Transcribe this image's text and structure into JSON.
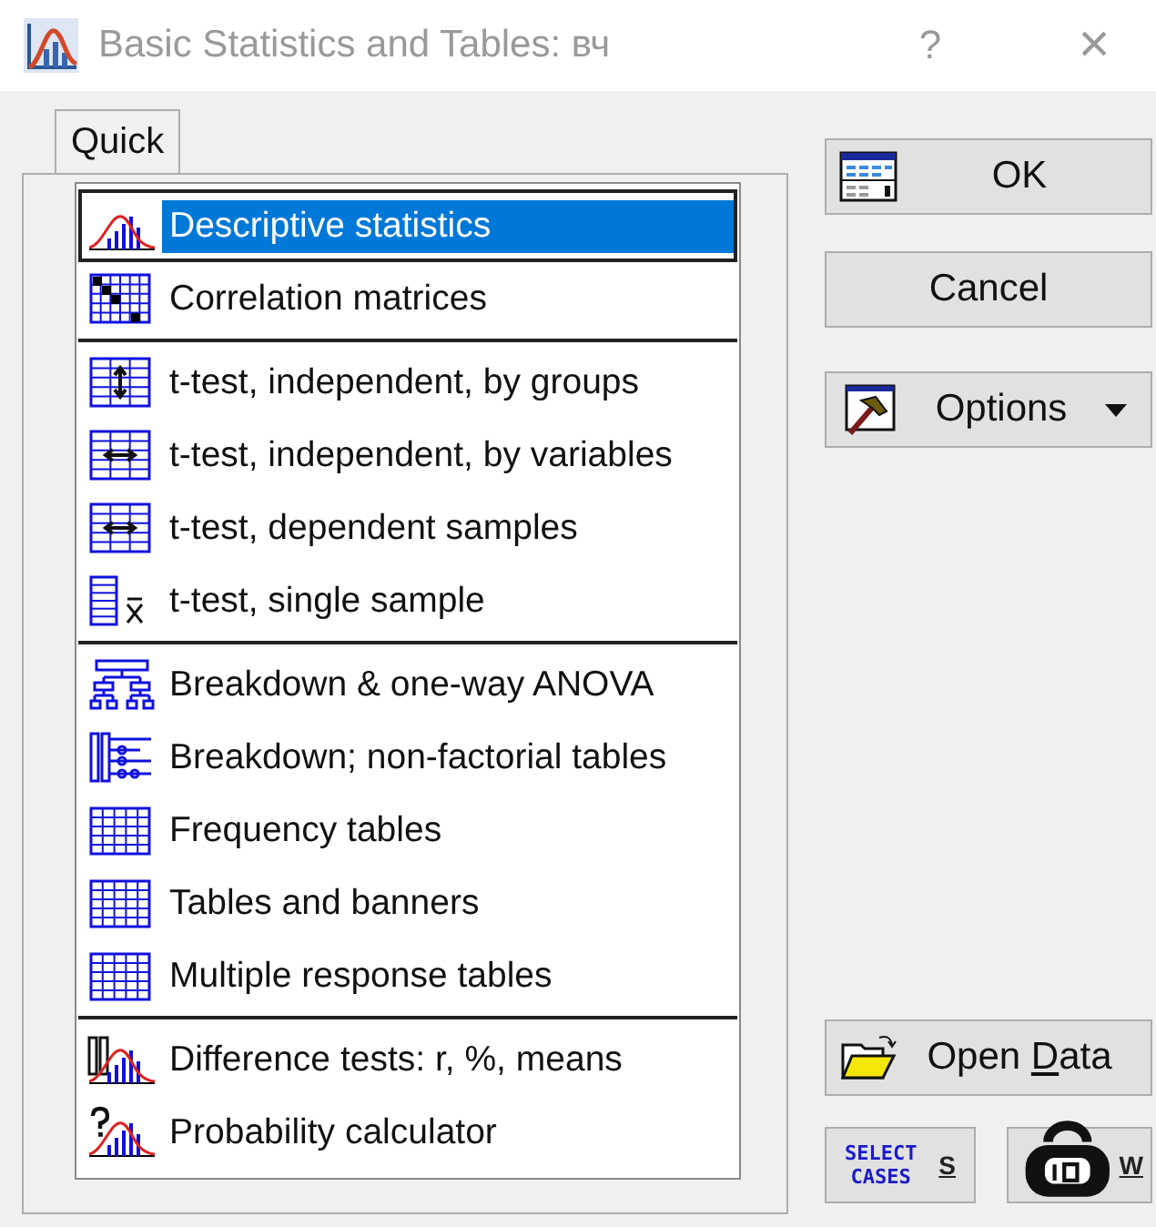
{
  "window": {
    "title": "Basic Statistics and Tables: вч",
    "help": "?",
    "close": "×"
  },
  "tabs": [
    {
      "label": "Quick",
      "selected": true
    }
  ],
  "groups": [
    {
      "items": [
        {
          "kind": "distribution",
          "label": "Descriptive statistics",
          "selected": true
        },
        {
          "kind": "matrix",
          "label": "Correlation matrices",
          "selected": false
        }
      ]
    },
    {
      "items": [
        {
          "kind": "groups",
          "label": "t-test, independent, by groups",
          "selected": false
        },
        {
          "kind": "variables",
          "label": "t-test, independent, by variables",
          "selected": false
        },
        {
          "kind": "variables",
          "label": "t-test, dependent samples",
          "selected": false
        },
        {
          "kind": "single",
          "label": "t-test, single sample",
          "selected": false
        }
      ]
    },
    {
      "items": [
        {
          "kind": "tree",
          "label": "Breakdown & one-way ANOVA",
          "selected": false
        },
        {
          "kind": "nonfactorial",
          "label": "Breakdown; non-factorial tables",
          "selected": false
        },
        {
          "kind": "table",
          "label": "Frequency tables",
          "selected": false
        },
        {
          "kind": "table",
          "label": "Tables and banners",
          "selected": false
        },
        {
          "kind": "table",
          "label": "Multiple response tables",
          "selected": false
        }
      ]
    },
    {
      "items": [
        {
          "kind": "difference",
          "label": "Difference tests: r, %, means",
          "selected": false
        },
        {
          "kind": "probability",
          "label": "Probability calculator",
          "selected": false
        }
      ]
    }
  ],
  "buttons": [
    {
      "kind": "ok",
      "label": "OK"
    },
    {
      "kind": "cancel",
      "label": "Cancel"
    },
    {
      "kind": "options",
      "label": "Options"
    }
  ],
  "bottom_buttons": {
    "open_data": {
      "label_before": "Open ",
      "mnemonic": "D",
      "label_after": "ata"
    },
    "select_cases": {
      "icon_text": [
        "SELECT",
        "CASES"
      ],
      "mnemonic": "S"
    },
    "weight": {
      "mnemonic": "W"
    }
  }
}
